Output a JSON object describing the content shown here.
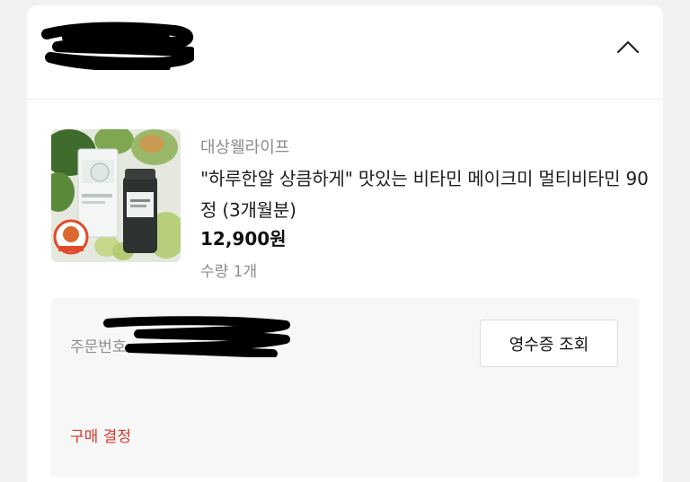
{
  "product": {
    "brand": "대상웰라이프",
    "name": "\"하루한알 상큼하게\" 맛있는 비타민 메이크미 멀티비타민 90정 (3개월분)",
    "price": "12,900원",
    "quantity": "수량 1개"
  },
  "order": {
    "number_label": "주문번호",
    "receipt_button": "영수증 조회",
    "status": "구매 결정"
  },
  "icons": {
    "collapse": "chevron-up-icon"
  },
  "colors": {
    "status_red": "#d63b2f",
    "page_background": "#f2f2f2"
  }
}
